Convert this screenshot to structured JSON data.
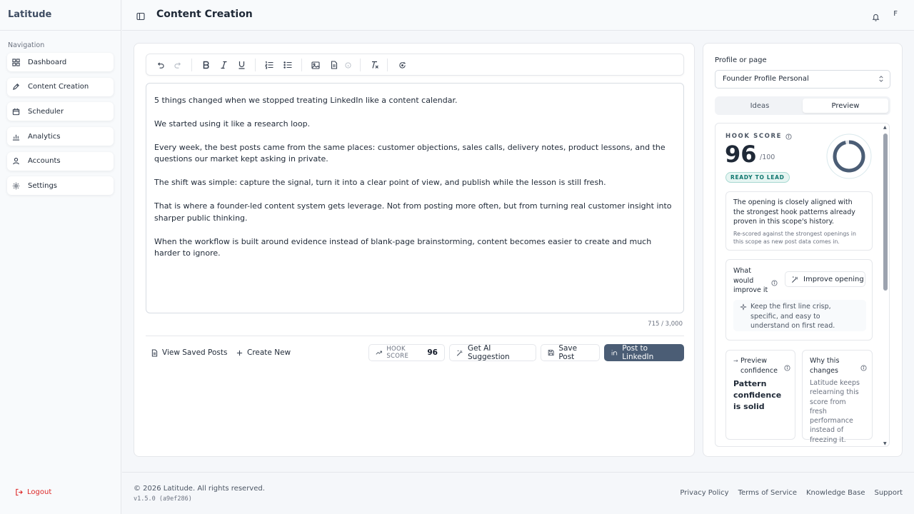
{
  "app": {
    "brand": "Latitude"
  },
  "sidebar": {
    "heading": "Navigation",
    "items": [
      {
        "label": "Dashboard",
        "icon": "dashboard-icon"
      },
      {
        "label": "Content Creation",
        "icon": "pen-icon"
      },
      {
        "label": "Scheduler",
        "icon": "calendar-icon"
      },
      {
        "label": "Analytics",
        "icon": "bar-chart-icon"
      },
      {
        "label": "Accounts",
        "icon": "user-icon"
      },
      {
        "label": "Settings",
        "icon": "gear-icon"
      }
    ],
    "logout_label": "Logout"
  },
  "header": {
    "title": "Content Creation",
    "avatar_initial": "F"
  },
  "editor": {
    "paragraphs": [
      "5 things changed when we stopped treating LinkedIn like a content calendar.",
      "We started using it like a research loop.",
      "Every week, the best posts came from the same places: customer objections, sales calls, delivery notes, product lessons, and the questions our market kept asking in private.",
      "The shift was simple: capture the signal, turn it into a clear point of view, and publish while the lesson is still fresh.",
      "That is where a founder-led content system gets leverage. Not from posting more often, but from turning real customer insight into sharper public thinking.",
      "When the workflow is built around evidence instead of blank-page brainstorming, content becomes easier to create and much harder to ignore."
    ],
    "char_count": "715 / 3,000"
  },
  "actions": {
    "view_saved": "View Saved Posts",
    "create_new": "Create New",
    "hook_label": "HOOK SCORE",
    "hook_value": "96",
    "ai_suggestion": "Get AI Suggestion",
    "save_post": "Save Post",
    "post_linkedin": "Post to LinkedIn"
  },
  "panel": {
    "profile_label": "Profile or page",
    "profile_value": "Founder Profile Personal",
    "tabs": [
      "Ideas",
      "Preview"
    ],
    "active_tab": "Preview",
    "hook": {
      "label": "HOOK SCORE",
      "value": "96",
      "max": "/100",
      "score_fraction": 0.96,
      "badge": "READY TO LEAD",
      "summary": "The opening is closely aligned with the strongest hook patterns already proven in this scope's history.",
      "note": "Re-scored against the strongest openings in this scope as new post data comes in."
    },
    "improve": {
      "question": "What would improve it",
      "button": "Improve opening",
      "tip": "Keep the first line crisp, specific, and easy to understand on first read."
    },
    "confidence": {
      "heading": "Preview confidence",
      "value": "Pattern confidence is solid"
    },
    "why": {
      "heading": "Why this changes",
      "text": "Latitude keeps relearning this score from fresh performance instead of freezing it."
    }
  },
  "footer": {
    "copyright": "© 2026 Latitude. All rights reserved.",
    "version": "v1.5.0 (a9ef286)",
    "links": [
      "Privacy Policy",
      "Terms of Service",
      "Knowledge Base",
      "Support"
    ]
  },
  "colors": {
    "accent": "#4b5d75",
    "ring": "#4b5d75",
    "ring_track": "#d9e8ec",
    "badge_text": "#0f766e",
    "logout": "#dc2626"
  }
}
